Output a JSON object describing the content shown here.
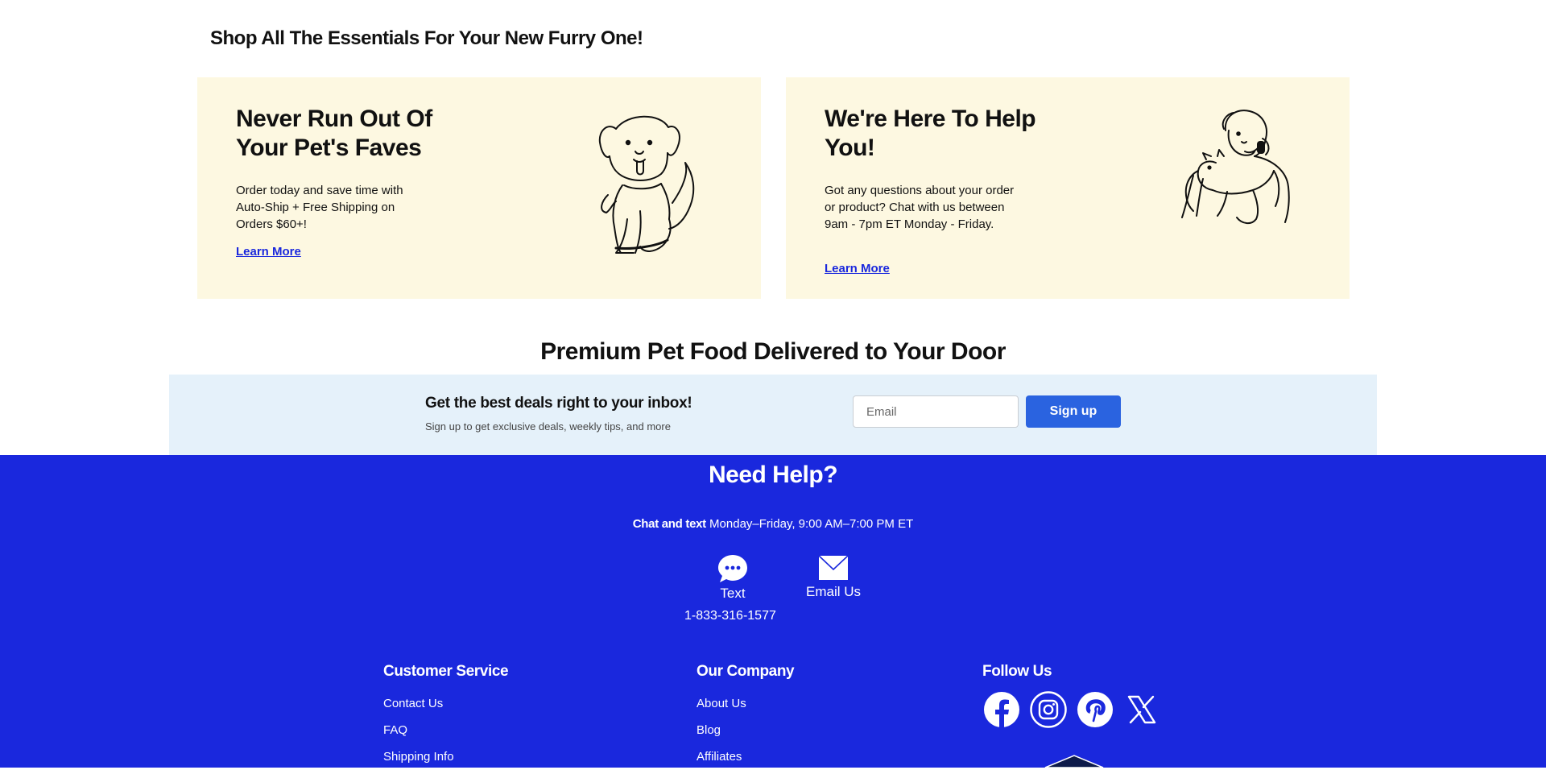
{
  "essentials": {
    "title": "Shop All The Essentials For Your New Furry One!",
    "cards": [
      {
        "heading": "Never Run Out Of Your Pet's Faves",
        "body": "Order today and save time with Auto-Ship + Free Shipping on Orders $60+!",
        "link": "Learn More",
        "icon": "dog-illustration"
      },
      {
        "heading": "We're Here To Help You!",
        "body": "Got any questions about your order or product? Chat with us between 9am - 7pm ET Monday - Friday.",
        "link": "Learn More",
        "icon": "support-agent-with-cat-illustration"
      }
    ]
  },
  "premium": {
    "title": "Premium Pet Food Delivered to Your Door"
  },
  "newsletter": {
    "heading": "Get the best deals right to your inbox!",
    "subtext": "Sign up to get exclusive deals, weekly tips, and more",
    "email_placeholder": "Email",
    "button_label": "Sign up"
  },
  "footer": {
    "help_title": "Need Help?",
    "hours_bold": "Chat and text",
    "hours_text": " Monday–Friday, 9:00 AM–7:00 PM ET",
    "contact": {
      "text_label": "Text",
      "email_label": "Email Us",
      "phone": "1-833-316-1577"
    },
    "customer_service": {
      "title": "Customer Service",
      "links": [
        "Contact Us",
        "FAQ",
        "Shipping Info"
      ]
    },
    "our_company": {
      "title": "Our Company",
      "links": [
        "About Us",
        "Blog",
        "Affiliates"
      ]
    },
    "follow_us": {
      "title": "Follow Us",
      "icons": [
        "facebook-icon",
        "instagram-icon",
        "pinterest-icon",
        "x-icon"
      ]
    }
  },
  "colors": {
    "footer_bg": "#1a28dd",
    "card_bg": "#fdf8e1",
    "newsletter_bg": "#e5f1fa",
    "signup_button": "#2a63e0",
    "link": "#1a28dd"
  }
}
